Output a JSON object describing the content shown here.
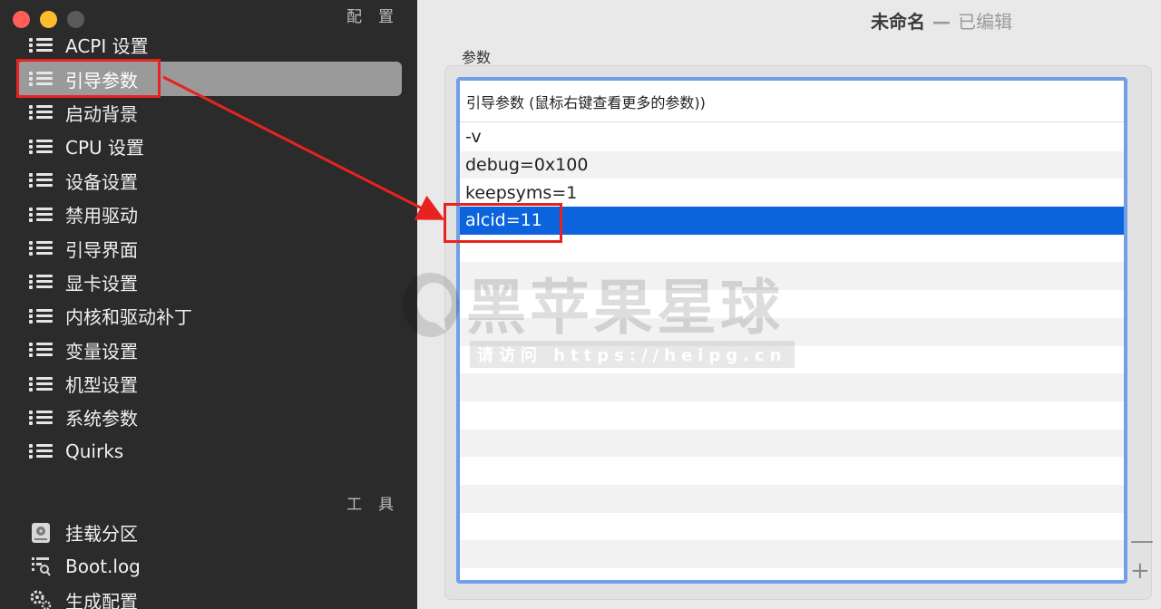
{
  "sidebar": {
    "section_config": "配置",
    "section_tools": "工具",
    "items": [
      {
        "label": "ACPI 设置"
      },
      {
        "label": "引导参数"
      },
      {
        "label": "启动背景"
      },
      {
        "label": "CPU 设置"
      },
      {
        "label": "设备设置"
      },
      {
        "label": "禁用驱动"
      },
      {
        "label": "引导界面"
      },
      {
        "label": "显卡设置"
      },
      {
        "label": "内核和驱动补丁"
      },
      {
        "label": "变量设置"
      },
      {
        "label": "机型设置"
      },
      {
        "label": "系统参数"
      },
      {
        "label": "Quirks"
      }
    ],
    "selected_index": 1,
    "tools": [
      {
        "label": "挂载分区",
        "icon": "disk-icon"
      },
      {
        "label": "Boot.log",
        "icon": "log-search-icon"
      },
      {
        "label": "生成配置",
        "icon": "gears-icon"
      }
    ]
  },
  "window": {
    "title": "未命名",
    "separator": "—",
    "status": "已编辑"
  },
  "main": {
    "params_label": "参数",
    "table_header": "引导参数 (鼠标右键查看更多的参数))",
    "rows": [
      "-v",
      "debug=0x100",
      "keepsyms=1",
      "alcid=11"
    ],
    "selected_row": 3,
    "minus_label": "—",
    "plus_label": "+"
  },
  "watermark": {
    "title": "黑苹果星球",
    "subtitle": "请访问 https://heipg.cn"
  },
  "colors": {
    "sidebar_bg": "#2b2b2b",
    "selection_blue": "#0b64dc",
    "annotation_red": "#e8231f",
    "table_border": "#6f9fe6"
  }
}
